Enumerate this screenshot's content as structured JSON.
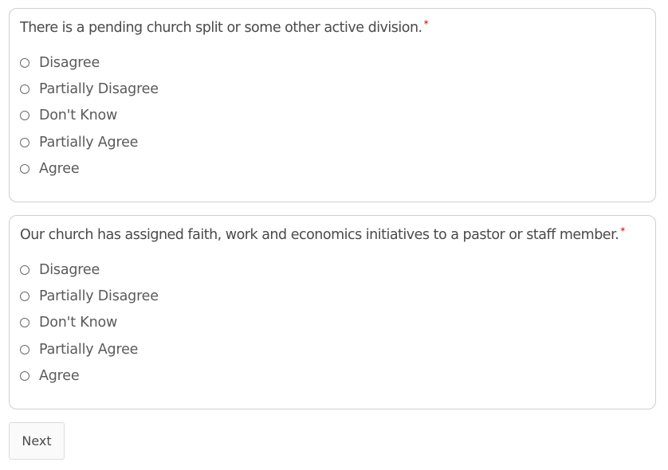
{
  "questions": [
    {
      "text": "There is a pending church split or some other active division.",
      "required_mark": "*",
      "options": [
        {
          "label": "Disagree",
          "selected": false
        },
        {
          "label": "Partially Disagree",
          "selected": false
        },
        {
          "label": "Don't Know",
          "selected": false
        },
        {
          "label": "Partially Agree",
          "selected": false
        },
        {
          "label": "Agree",
          "selected": false
        }
      ]
    },
    {
      "text": "Our church has assigned faith, work and economics initiatives to a pastor or staff member.",
      "required_mark": "*",
      "options": [
        {
          "label": "Disagree",
          "selected": false
        },
        {
          "label": "Partially Disagree",
          "selected": false
        },
        {
          "label": "Don't Know",
          "selected": false
        },
        {
          "label": "Partially Agree",
          "selected": false
        },
        {
          "label": "Agree",
          "selected": false
        }
      ]
    }
  ],
  "next_label": "Next",
  "colors": {
    "required": "#d20000",
    "border": "#cfcfcf",
    "text": "#4a4a4a"
  }
}
